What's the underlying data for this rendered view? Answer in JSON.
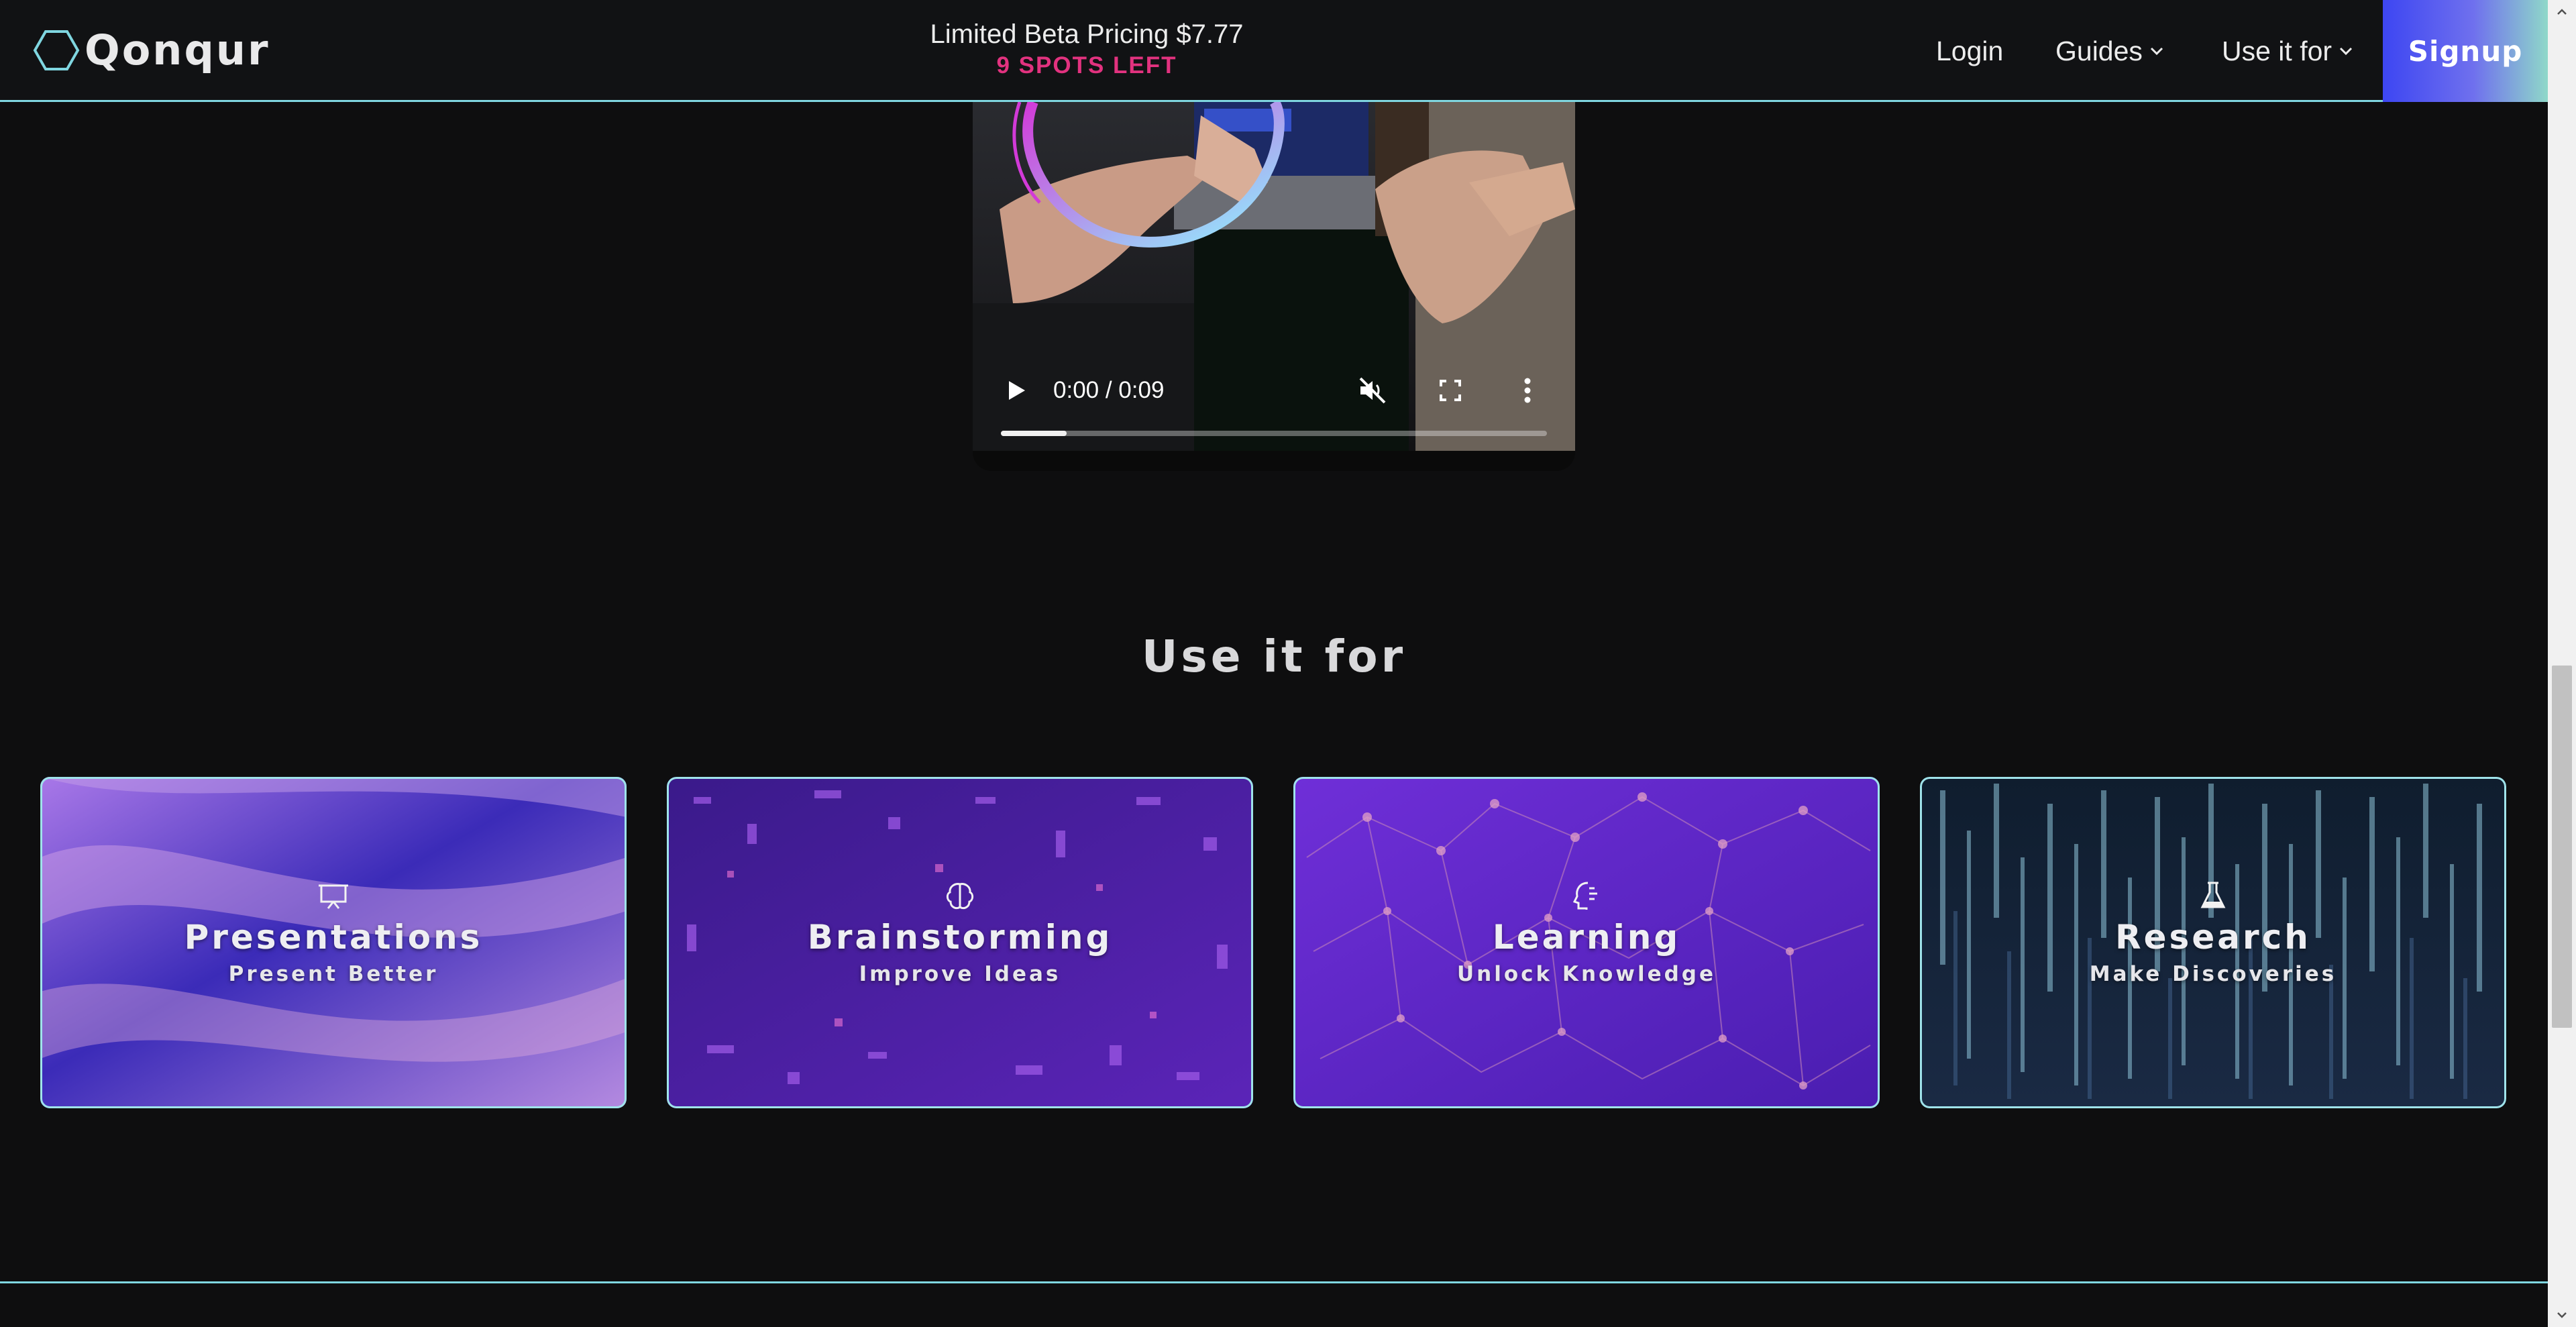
{
  "header": {
    "logo_text": "Qonqur",
    "promo_title": "Limited Beta Pricing $7.77",
    "promo_subtitle": "9 SPOTS LEFT",
    "nav": {
      "login": "Login",
      "guides": "Guides",
      "use_it_for": "Use it for"
    },
    "signup": "Signup",
    "colors": {
      "accent_line": "#7fd6e0",
      "promo_subtitle": "#e2327f"
    }
  },
  "video": {
    "time": "0:00 / 0:09",
    "progress": 0.12,
    "icons": [
      "play-icon",
      "mute-icon",
      "fullscreen-icon",
      "more-icon"
    ]
  },
  "section": {
    "title": "Use it for"
  },
  "cards": [
    {
      "title": "Presentations",
      "subtitle": "Present Better",
      "icon": "presentation-icon"
    },
    {
      "title": "Brainstorming",
      "subtitle": "Improve Ideas",
      "icon": "brain-icon"
    },
    {
      "title": "Learning",
      "subtitle": "Unlock Knowledge",
      "icon": "head-icon"
    },
    {
      "title": "Research",
      "subtitle": "Make Discoveries",
      "icon": "flask-icon"
    }
  ]
}
